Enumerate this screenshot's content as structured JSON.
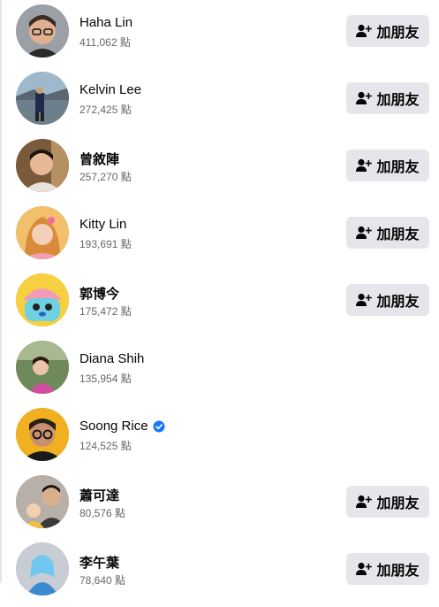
{
  "people": [
    {
      "name": "Haha Lin",
      "points": "411,062 點",
      "button": "加朋友",
      "verified": false,
      "avatar_icon": "avatar-man-glasses"
    },
    {
      "name": "Kelvin Lee",
      "points": "272,425 點",
      "button": "加朋友",
      "verified": false,
      "avatar_icon": "avatar-harbor"
    },
    {
      "name": "曾敘陣",
      "points": "257,270 點",
      "button": "加朋友",
      "verified": false,
      "avatar_icon": "avatar-young-man"
    },
    {
      "name": "Kitty Lin",
      "points": "193,691 點",
      "button": "加朋友",
      "verified": false,
      "avatar_icon": "avatar-woman"
    },
    {
      "name": "郭博今",
      "points": "175,472 點",
      "button": "加朋友",
      "verified": false,
      "avatar_icon": "avatar-cartoon-chopper"
    },
    {
      "name": "Diana Shih",
      "points": "135,954 點",
      "button": "",
      "verified": false,
      "avatar_icon": "avatar-outdoor-woman"
    },
    {
      "name": "Soong Rice",
      "points": "124,525 點",
      "button": "",
      "verified": true,
      "avatar_icon": "avatar-man-glasses-sunlight"
    },
    {
      "name": "蕭可達",
      "points": "80,576 點",
      "button": "加朋友",
      "verified": false,
      "avatar_icon": "avatar-father-child"
    },
    {
      "name": "李午葉",
      "points": "78,640 點",
      "button": "加朋友",
      "verified": false,
      "avatar_icon": "avatar-cosplay"
    }
  ],
  "colors": {
    "button_bg": "#e4e6eb",
    "verified_blue": "#1877f2",
    "secondary_text": "#65676b"
  }
}
